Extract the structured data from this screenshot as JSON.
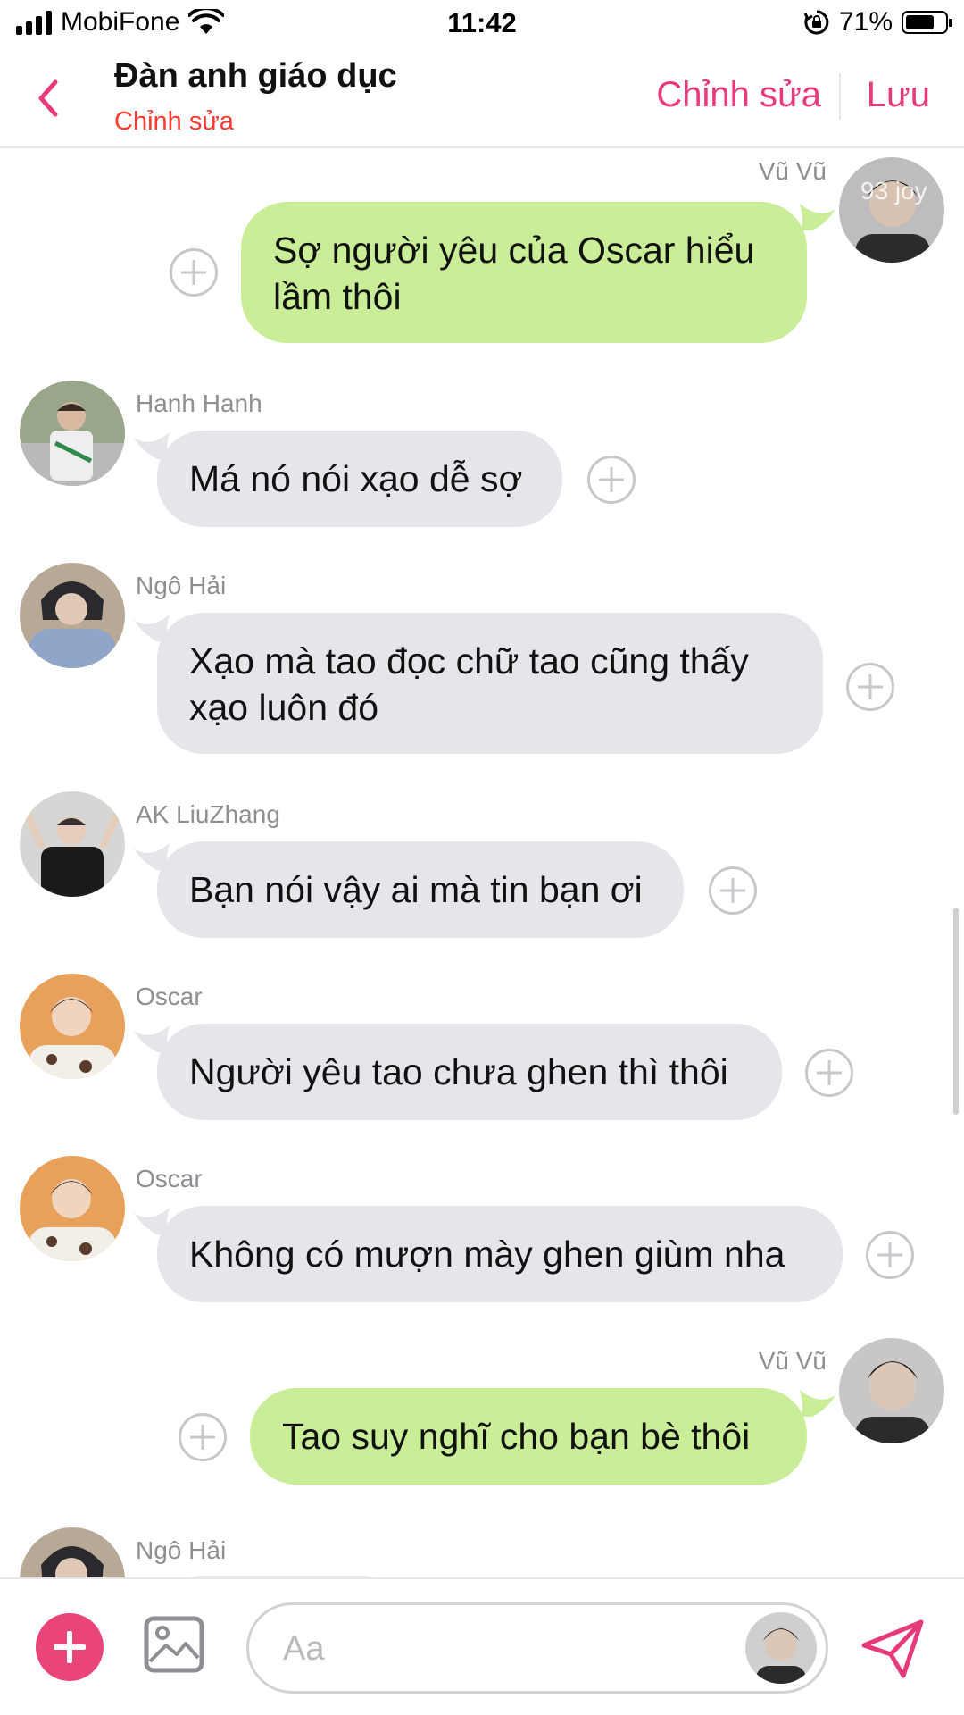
{
  "status_bar": {
    "carrier": "MobiFone",
    "time": "11:42",
    "battery": "71%",
    "battery_level": 0.71
  },
  "header": {
    "title": "Đàn anh giáo dục",
    "subtitle": "Chỉnh sửa",
    "edit_label": "Chỉnh sửa",
    "save_label": "Lưu",
    "accent_color": "#e8397a"
  },
  "messages": [
    {
      "sender": "Vũ Vũ",
      "direction": "out",
      "text": "Sợ người yêu của Oscar hiểu lầm thôi",
      "avatar_overlay": "93 joy"
    },
    {
      "sender": "Hanh Hanh",
      "direction": "in",
      "text": "Má nó nói xạo dễ sợ"
    },
    {
      "sender": "Ngô Hải",
      "direction": "in",
      "text": "Xạo mà tao đọc chữ tao cũng thấy xạo luôn đó"
    },
    {
      "sender": "AK LiuZhang",
      "direction": "in",
      "text": "Bạn nói vậy ai mà tin bạn ơi"
    },
    {
      "sender": "Oscar",
      "direction": "in",
      "text": "Người yêu tao chưa ghen thì thôi"
    },
    {
      "sender": "Oscar",
      "direction": "in",
      "text": "Không có mượn mày ghen giùm nha"
    },
    {
      "sender": "Vũ Vũ",
      "direction": "out",
      "text": "Tao suy nghĩ cho bạn bè thôi"
    },
    {
      "sender": "Ngô Hải",
      "direction": "in",
      "text": ""
    }
  ],
  "composer": {
    "placeholder": "Aa"
  },
  "colors": {
    "incoming_bubble": "#e5e6ea",
    "outgoing_bubble": "#c9ee97",
    "add_button": "#ea4579"
  }
}
